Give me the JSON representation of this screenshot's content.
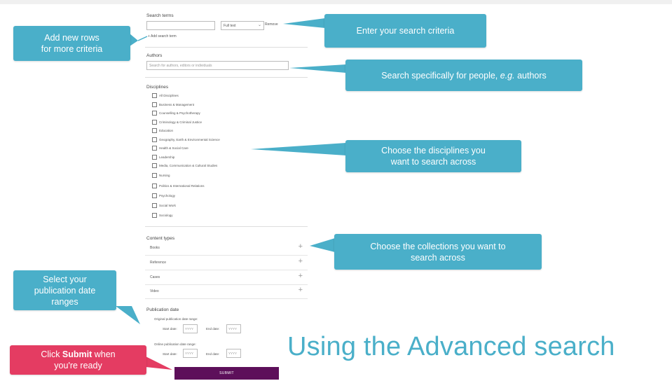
{
  "form": {
    "search_terms_label": "Search terms",
    "search_input_value": "",
    "field_select_value": "Full text",
    "remove_label": "Remove",
    "add_search_term": "+  Add search term",
    "authors_label": "Authors",
    "authors_placeholder": "Search for authors, editors or individuals",
    "disciplines_label": "Disciplines",
    "disciplines": [
      "All Disciplines",
      "Business & Management",
      "Counselling & Psychotherapy",
      "Criminology & Criminal Justice",
      "Education",
      "Geography, Earth & Environmental Science",
      "Health & Social Care",
      "Leadership",
      "Media, Communication & Cultural Studies",
      "Nursing",
      "Politics & International Relations",
      "Psychology",
      "Social Work",
      "Sociology"
    ],
    "content_types_label": "Content types",
    "content_types": [
      "Books",
      "Reference",
      "Cases",
      "Video"
    ],
    "publication_date_label": "Publication date",
    "original_range_label": "Original publication date range:",
    "online_range_label": "Online publication date range:",
    "start_date_label": "Start date:",
    "end_date_label": "End date:",
    "date_placeholder": "YYYY",
    "submit_label": "SUBMIT"
  },
  "callouts": {
    "add_rows_line1": "Add new rows",
    "add_rows_line2": "for more criteria",
    "enter_criteria": "Enter your search criteria",
    "search_people_prefix": "Search specifically for people, ",
    "search_people_italic": "e.g.",
    "search_people_suffix": " authors",
    "disciplines_line1": "Choose the disciplines you",
    "disciplines_line2": "want to search across",
    "collections_line1": "Choose the collections you want to",
    "collections_line2": "search across",
    "date_line1": "Select your",
    "date_line2": "publication date",
    "date_line3": "ranges",
    "submit_pre": "Click ",
    "submit_bold": "Submit",
    "submit_post": " when",
    "submit_line2": "you're ready"
  },
  "slide_title": "Using the Advanced search",
  "colors": {
    "callout_blue": "#4aafc9",
    "callout_pink": "#e43c62",
    "submit_purple": "#5d0f5a",
    "title_blue": "#4aafc9"
  }
}
